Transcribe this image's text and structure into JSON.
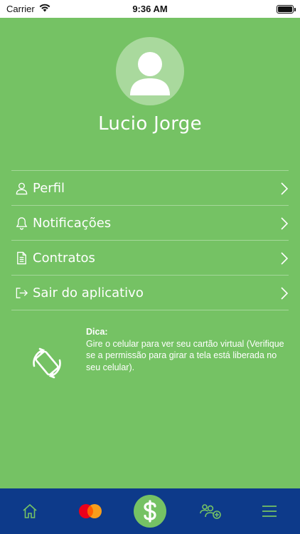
{
  "status_bar": {
    "carrier": "Carrier",
    "time": "9:36 AM"
  },
  "profile": {
    "name": "Lucio Jorge"
  },
  "menu": {
    "items": [
      {
        "label": "Perfil",
        "icon": "user-icon"
      },
      {
        "label": "Notificações",
        "icon": "bell-icon"
      },
      {
        "label": "Contratos",
        "icon": "document-icon"
      },
      {
        "label": "Sair do aplicativo",
        "icon": "logout-icon"
      }
    ]
  },
  "tip": {
    "title": "Dica:",
    "body": "Gire o celular para ver seu cartão virtual (Verifique se a permissão para girar a tela está liberada no seu celular).",
    "icon": "rotate-phone-icon"
  },
  "bottom_nav": {
    "items": [
      {
        "name": "home",
        "icon": "home-icon"
      },
      {
        "name": "card",
        "icon": "mastercard-icon"
      },
      {
        "name": "payments",
        "icon": "dollar-icon"
      },
      {
        "name": "add-user",
        "icon": "add-user-icon"
      },
      {
        "name": "menu",
        "icon": "hamburger-icon"
      }
    ]
  },
  "colors": {
    "background": "#75c264",
    "nav_background": "#0d3a8a",
    "nav_icon": "#75c264",
    "text": "#ffffff"
  }
}
